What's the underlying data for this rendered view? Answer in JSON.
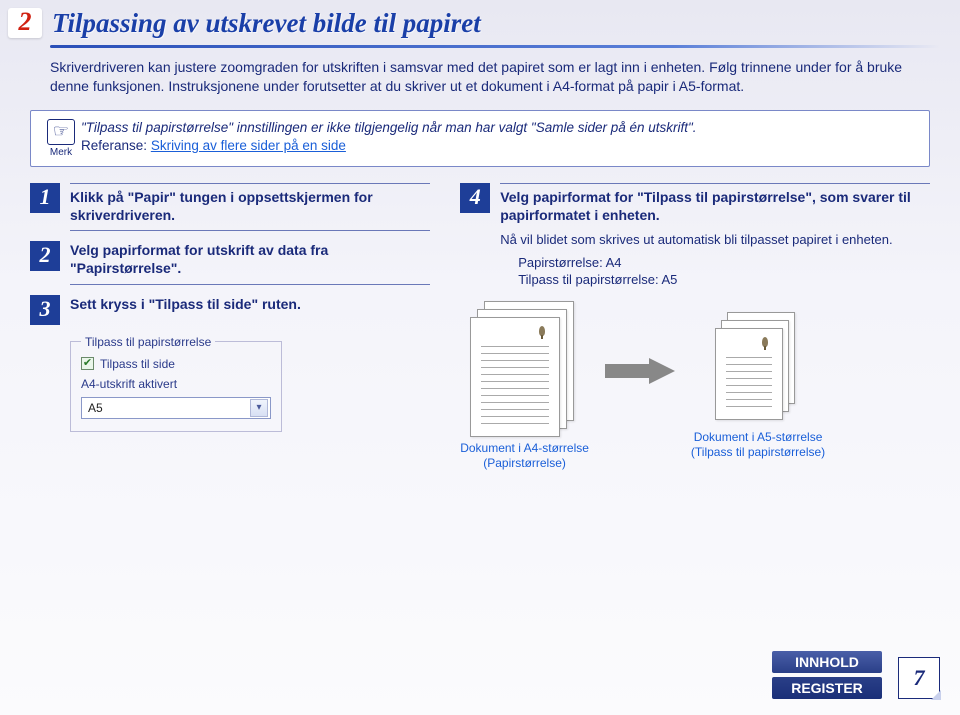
{
  "section_number": "2",
  "title": "Tilpassing av utskrevet bilde til papiret",
  "intro": "Skriverdriveren kan justere zoomgraden for utskriften i samsvar med det papiret som er lagt inn i enheten. Følg trinnene under for å bruke denne funksjonen. Instruksjonene under forutsetter at du skriver ut et dokument i A4-format på papir i A5-format.",
  "note": {
    "label": "Merk",
    "text": "\"Tilpass til papirstørrelse\" innstillingen er ikke tilgjengelig når man har valgt \"Samle sider på én utskrift\".",
    "ref_label": "Referanse:",
    "ref_link": "Skriving av flere sider på en side"
  },
  "steps": [
    {
      "num": "1",
      "text": "Klikk på \"Papir\" tungen i oppsettskjermen for skriverdriveren."
    },
    {
      "num": "2",
      "text": "Velg papirformat for utskrift av data fra \"Papirstørrelse\"."
    },
    {
      "num": "3",
      "text": "Sett kryss i \"Tilpass til side\" ruten."
    }
  ],
  "step4": {
    "num": "4",
    "text": "Velg papirformat for \"Tilpass til papirstørrelse\", som svarer til papirformatet i enheten.",
    "sub": "Nå vil blidet som skrives ut automatisk bli tilpasset papiret i enheten.",
    "spec1": "Papirstørrelse: A4",
    "spec2": "Tilpass til papirstørrelse: A5"
  },
  "ui": {
    "legend": "Tilpass til papirstørrelse",
    "check_label": "Tilpass til side",
    "status": "A4-utskrift aktivert",
    "select_value": "A5"
  },
  "diagram": {
    "caption_a4_line1": "Dokument i A4-størrelse",
    "caption_a4_line2": "(Papirstørrelse)",
    "caption_a5_line1": "Dokument i A5-størrelse",
    "caption_a5_line2": "(Tilpass til papirstørrelse)"
  },
  "footer": {
    "innhold": "INNHOLD",
    "register": "REGISTER",
    "page": "7"
  }
}
